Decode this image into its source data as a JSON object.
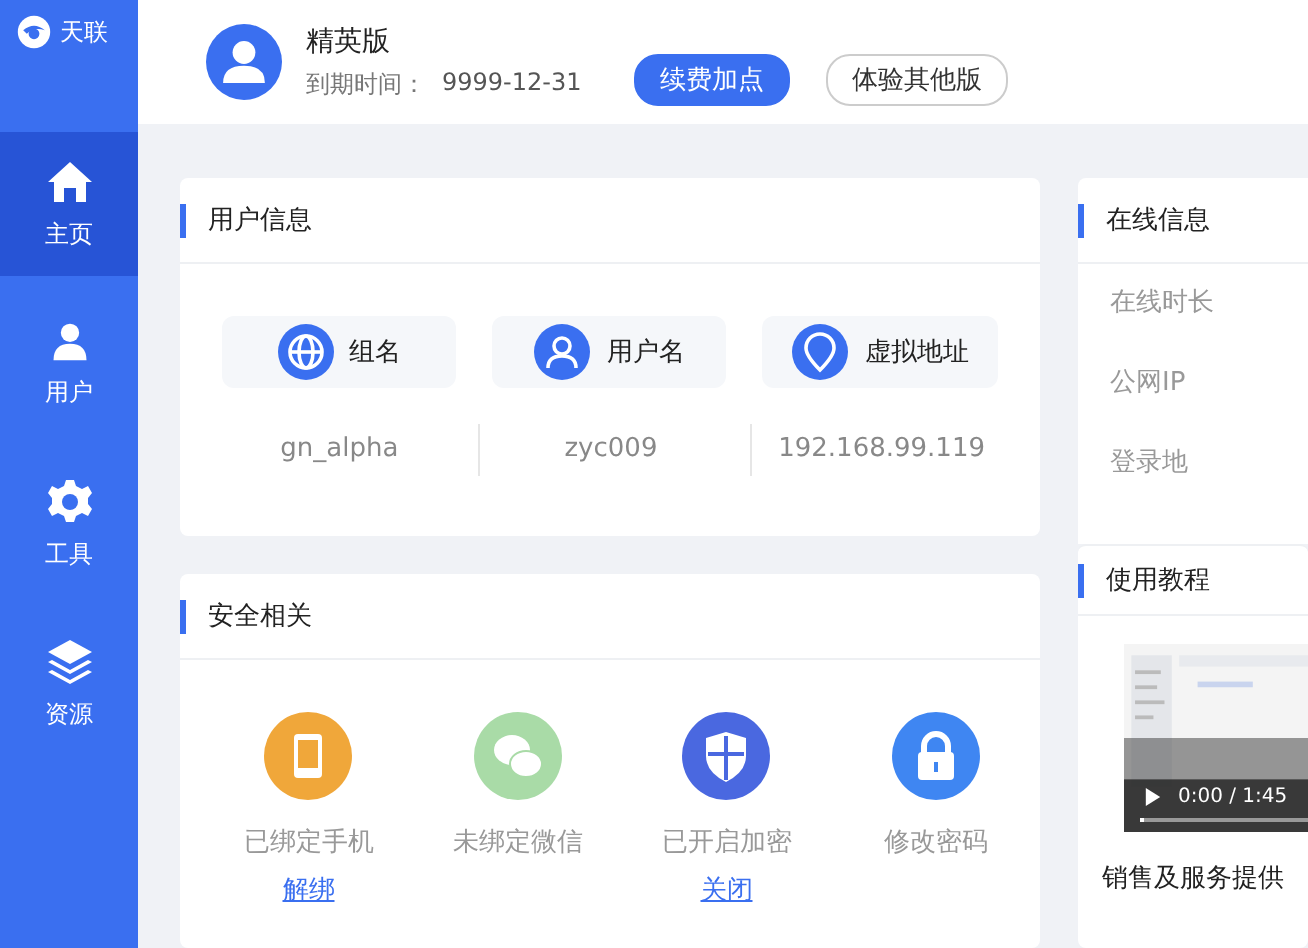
{
  "brand": {
    "name": "天联"
  },
  "nav": [
    {
      "label": "主页",
      "kind": "home",
      "selected": true
    },
    {
      "label": "用户",
      "kind": "user",
      "selected": false
    },
    {
      "label": "工具",
      "kind": "gear",
      "selected": false
    },
    {
      "label": "资源",
      "kind": "layers",
      "selected": false
    }
  ],
  "header": {
    "plan": "精英版",
    "expiry_label": "到期时间：",
    "expiry": "9999-12-31",
    "buttons": [
      {
        "label": "续费加点",
        "kind": "primary"
      },
      {
        "label": "体验其他版",
        "kind": "outline"
      }
    ]
  },
  "user_info": {
    "title": "用户信息",
    "fields": [
      {
        "label": "组名",
        "kind": "globe",
        "value": "gn_alpha"
      },
      {
        "label": "用户名",
        "kind": "person",
        "value": "zyc009"
      },
      {
        "label": "虚拟地址",
        "kind": "pin",
        "value": "192.168.99.119"
      }
    ]
  },
  "security": {
    "title": "安全相关",
    "items": [
      {
        "kind": "phone",
        "color": "#f0a73a",
        "label": "已绑定手机",
        "link": "解绑"
      },
      {
        "kind": "wechat",
        "color": "#a9dba7",
        "label": "未绑定微信"
      },
      {
        "kind": "shield",
        "color": "#4a68e0",
        "label": "已开启加密",
        "link": "关闭"
      },
      {
        "kind": "lock",
        "color": "#3f86f2",
        "label": "修改密码"
      }
    ]
  },
  "online_info": {
    "title": "在线信息",
    "rows": [
      "在线时长",
      "公网IP",
      "登录地"
    ]
  },
  "tutorial": {
    "title": "使用教程",
    "video": {
      "time": "0:00 / 1:45",
      "level": 0.02
    },
    "caption": "销售及服务提供"
  }
}
